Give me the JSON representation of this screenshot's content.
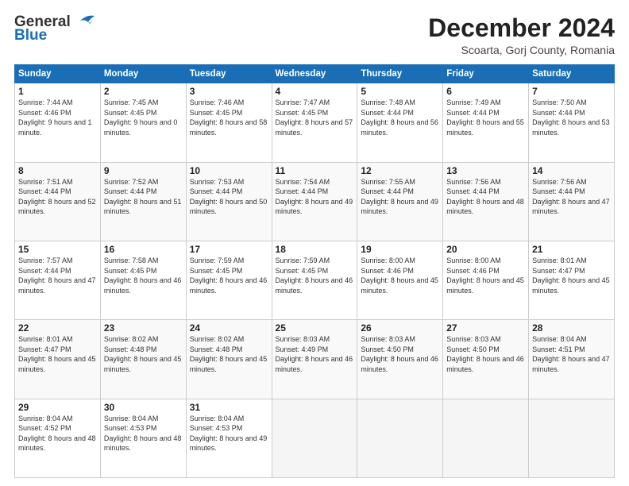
{
  "header": {
    "logo_general": "General",
    "logo_blue": "Blue",
    "main_title": "December 2024",
    "subtitle": "Scoarta, Gorj County, Romania"
  },
  "calendar": {
    "days_of_week": [
      "Sunday",
      "Monday",
      "Tuesday",
      "Wednesday",
      "Thursday",
      "Friday",
      "Saturday"
    ],
    "weeks": [
      [
        null,
        {
          "day": "2",
          "sunrise": "Sunrise: 7:45 AM",
          "sunset": "Sunset: 4:45 PM",
          "daylight": "Daylight: 9 hours and 0 minutes."
        },
        {
          "day": "3",
          "sunrise": "Sunrise: 7:46 AM",
          "sunset": "Sunset: 4:45 PM",
          "daylight": "Daylight: 8 hours and 58 minutes."
        },
        {
          "day": "4",
          "sunrise": "Sunrise: 7:47 AM",
          "sunset": "Sunset: 4:45 PM",
          "daylight": "Daylight: 8 hours and 57 minutes."
        },
        {
          "day": "5",
          "sunrise": "Sunrise: 7:48 AM",
          "sunset": "Sunset: 4:44 PM",
          "daylight": "Daylight: 8 hours and 56 minutes."
        },
        {
          "day": "6",
          "sunrise": "Sunrise: 7:49 AM",
          "sunset": "Sunset: 4:44 PM",
          "daylight": "Daylight: 8 hours and 55 minutes."
        },
        {
          "day": "7",
          "sunrise": "Sunrise: 7:50 AM",
          "sunset": "Sunset: 4:44 PM",
          "daylight": "Daylight: 8 hours and 53 minutes."
        }
      ],
      [
        {
          "day": "8",
          "sunrise": "Sunrise: 7:51 AM",
          "sunset": "Sunset: 4:44 PM",
          "daylight": "Daylight: 8 hours and 52 minutes."
        },
        {
          "day": "9",
          "sunrise": "Sunrise: 7:52 AM",
          "sunset": "Sunset: 4:44 PM",
          "daylight": "Daylight: 8 hours and 51 minutes."
        },
        {
          "day": "10",
          "sunrise": "Sunrise: 7:53 AM",
          "sunset": "Sunset: 4:44 PM",
          "daylight": "Daylight: 8 hours and 50 minutes."
        },
        {
          "day": "11",
          "sunrise": "Sunrise: 7:54 AM",
          "sunset": "Sunset: 4:44 PM",
          "daylight": "Daylight: 8 hours and 49 minutes."
        },
        {
          "day": "12",
          "sunrise": "Sunrise: 7:55 AM",
          "sunset": "Sunset: 4:44 PM",
          "daylight": "Daylight: 8 hours and 49 minutes."
        },
        {
          "day": "13",
          "sunrise": "Sunrise: 7:56 AM",
          "sunset": "Sunset: 4:44 PM",
          "daylight": "Daylight: 8 hours and 48 minutes."
        },
        {
          "day": "14",
          "sunrise": "Sunrise: 7:56 AM",
          "sunset": "Sunset: 4:44 PM",
          "daylight": "Daylight: 8 hours and 47 minutes."
        }
      ],
      [
        {
          "day": "15",
          "sunrise": "Sunrise: 7:57 AM",
          "sunset": "Sunset: 4:44 PM",
          "daylight": "Daylight: 8 hours and 47 minutes."
        },
        {
          "day": "16",
          "sunrise": "Sunrise: 7:58 AM",
          "sunset": "Sunset: 4:45 PM",
          "daylight": "Daylight: 8 hours and 46 minutes."
        },
        {
          "day": "17",
          "sunrise": "Sunrise: 7:59 AM",
          "sunset": "Sunset: 4:45 PM",
          "daylight": "Daylight: 8 hours and 46 minutes."
        },
        {
          "day": "18",
          "sunrise": "Sunrise: 7:59 AM",
          "sunset": "Sunset: 4:45 PM",
          "daylight": "Daylight: 8 hours and 46 minutes."
        },
        {
          "day": "19",
          "sunrise": "Sunrise: 8:00 AM",
          "sunset": "Sunset: 4:46 PM",
          "daylight": "Daylight: 8 hours and 45 minutes."
        },
        {
          "day": "20",
          "sunrise": "Sunrise: 8:00 AM",
          "sunset": "Sunset: 4:46 PM",
          "daylight": "Daylight: 8 hours and 45 minutes."
        },
        {
          "day": "21",
          "sunrise": "Sunrise: 8:01 AM",
          "sunset": "Sunset: 4:47 PM",
          "daylight": "Daylight: 8 hours and 45 minutes."
        }
      ],
      [
        {
          "day": "22",
          "sunrise": "Sunrise: 8:01 AM",
          "sunset": "Sunset: 4:47 PM",
          "daylight": "Daylight: 8 hours and 45 minutes."
        },
        {
          "day": "23",
          "sunrise": "Sunrise: 8:02 AM",
          "sunset": "Sunset: 4:48 PM",
          "daylight": "Daylight: 8 hours and 45 minutes."
        },
        {
          "day": "24",
          "sunrise": "Sunrise: 8:02 AM",
          "sunset": "Sunset: 4:48 PM",
          "daylight": "Daylight: 8 hours and 45 minutes."
        },
        {
          "day": "25",
          "sunrise": "Sunrise: 8:03 AM",
          "sunset": "Sunset: 4:49 PM",
          "daylight": "Daylight: 8 hours and 46 minutes."
        },
        {
          "day": "26",
          "sunrise": "Sunrise: 8:03 AM",
          "sunset": "Sunset: 4:50 PM",
          "daylight": "Daylight: 8 hours and 46 minutes."
        },
        {
          "day": "27",
          "sunrise": "Sunrise: 8:03 AM",
          "sunset": "Sunset: 4:50 PM",
          "daylight": "Daylight: 8 hours and 46 minutes."
        },
        {
          "day": "28",
          "sunrise": "Sunrise: 8:04 AM",
          "sunset": "Sunset: 4:51 PM",
          "daylight": "Daylight: 8 hours and 47 minutes."
        }
      ],
      [
        {
          "day": "29",
          "sunrise": "Sunrise: 8:04 AM",
          "sunset": "Sunset: 4:52 PM",
          "daylight": "Daylight: 8 hours and 48 minutes."
        },
        {
          "day": "30",
          "sunrise": "Sunrise: 8:04 AM",
          "sunset": "Sunset: 4:53 PM",
          "daylight": "Daylight: 8 hours and 48 minutes."
        },
        {
          "day": "31",
          "sunrise": "Sunrise: 8:04 AM",
          "sunset": "Sunset: 4:53 PM",
          "daylight": "Daylight: 8 hours and 49 minutes."
        },
        null,
        null,
        null,
        null
      ]
    ],
    "week1_day1": {
      "day": "1",
      "sunrise": "Sunrise: 7:44 AM",
      "sunset": "Sunset: 4:46 PM",
      "daylight": "Daylight: 9 hours and 1 minute."
    }
  }
}
